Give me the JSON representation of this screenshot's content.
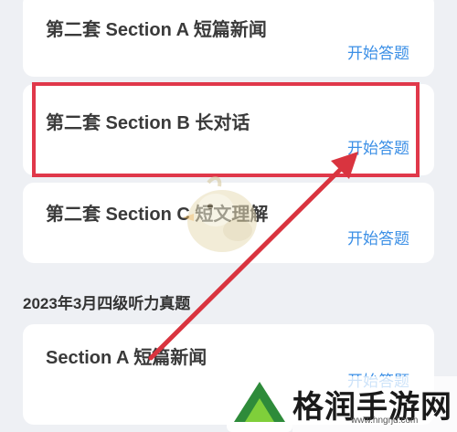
{
  "sections": [
    {
      "title": "第二套 Section A 短篇新闻",
      "action": "开始答题"
    },
    {
      "title": "第二套 Section B 长对话",
      "action": "开始答题"
    },
    {
      "title": "第二套 Section C 短文理解",
      "action": "开始答题"
    }
  ],
  "group": {
    "title": "2023年3月四级听力真题",
    "items": [
      {
        "title": "Section A 短篇新闻",
        "action": "开始答题"
      }
    ]
  },
  "watermark": {
    "brand": "格润手游网",
    "url": "www.hngrjd.com"
  },
  "colors": {
    "action": "#3b8fe6",
    "highlight": "#e0384a",
    "arrow": "#d9343f",
    "background": "#eef0f4"
  }
}
